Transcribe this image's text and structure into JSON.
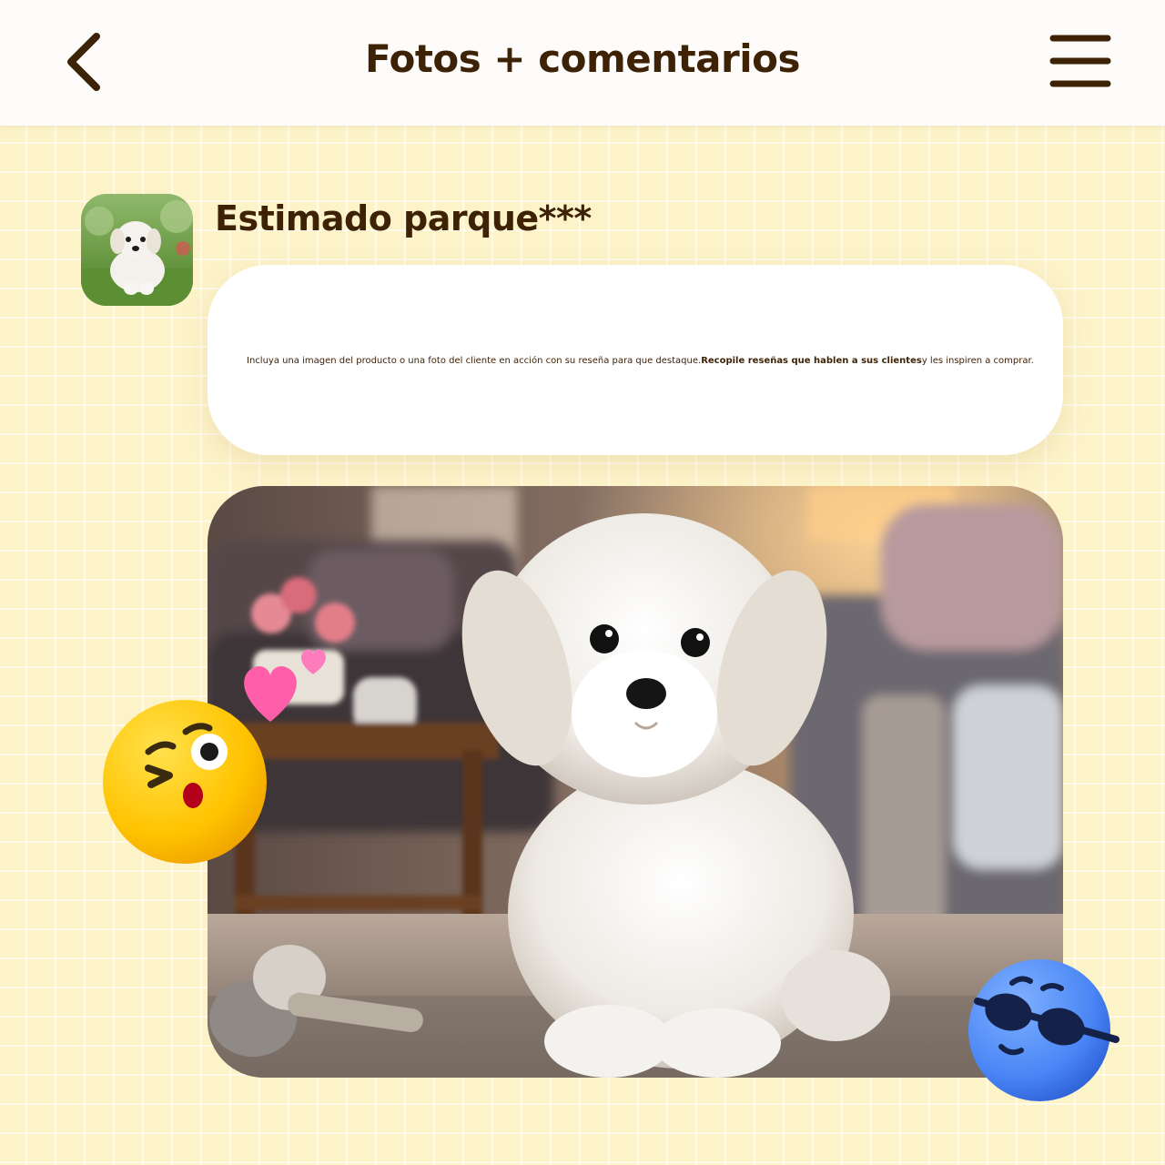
{
  "header": {
    "title": "Fotos + comentarios",
    "back_icon": "chevron-left-icon",
    "menu_icon": "hamburger-menu-icon"
  },
  "review": {
    "reviewer_name": "Estimado parque***",
    "text_part1": "Incluya una imagen del producto o una foto del cliente en acción con su reseña para que destaque.",
    "text_bold": "Recopile reseñas que hablen a sus clientes",
    "text_part2": "y les inspiren a comprar."
  },
  "colors": {
    "brand_brown": "#3e2206",
    "background_yellow": "#fdf3c9",
    "bubble_white": "#ffffff",
    "emoji_yellow": "#ffc300",
    "emoji_blue": "#4a86f5",
    "heart_pink": "#ff5fa8"
  },
  "icons": {
    "avatar": "puppy-avatar-icon",
    "photo": "puppy-photo",
    "emoji_wink": "winking-kiss-emoji-icon",
    "emoji_cool": "sunglasses-emoji-icon",
    "hearts": "heart-icon"
  }
}
